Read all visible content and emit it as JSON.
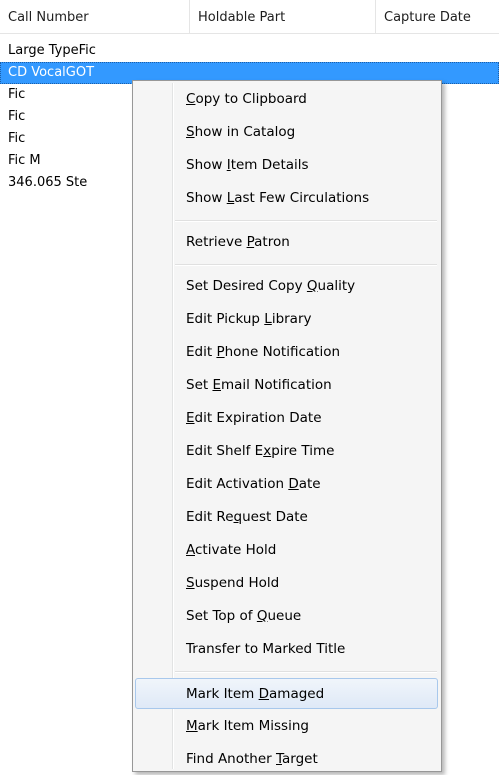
{
  "header": {
    "columns": [
      "Call Number",
      "Holdable Part",
      "Capture Date"
    ]
  },
  "rows": [
    {
      "call_number": "Large TypeFic",
      "selected": false
    },
    {
      "call_number": "CD VocalGOT",
      "selected": true
    },
    {
      "call_number": "Fic",
      "selected": false
    },
    {
      "call_number": "Fic",
      "selected": false
    },
    {
      "call_number": "Fic",
      "selected": false
    },
    {
      "call_number": "Fic M",
      "selected": false
    },
    {
      "call_number": "346.065 Ste",
      "selected": false
    }
  ],
  "context_menu": {
    "groups": [
      [
        {
          "label": "Copy to Clipboard",
          "accel": "C"
        },
        {
          "label": "Show in Catalog",
          "accel": "S"
        },
        {
          "label": "Show Item Details",
          "accel": "I"
        },
        {
          "label": "Show Last Few Circulations",
          "accel": "L"
        }
      ],
      [
        {
          "label": "Retrieve Patron",
          "accel": "P"
        }
      ],
      [
        {
          "label": "Set Desired Copy Quality",
          "accel": "Q"
        },
        {
          "label": "Edit Pickup Library",
          "accel": "L"
        },
        {
          "label": "Edit Phone Notification",
          "accel": "P"
        },
        {
          "label": "Set Email Notification",
          "accel": "E"
        },
        {
          "label": "Edit Expiration Date",
          "accel": "E"
        },
        {
          "label": "Edit Shelf Expire Time",
          "accel": "x"
        },
        {
          "label": "Edit Activation Date",
          "accel": "D"
        },
        {
          "label": "Edit Request Date",
          "accel": "q"
        },
        {
          "label": "Activate Hold",
          "accel": "A"
        },
        {
          "label": "Suspend Hold",
          "accel": "S"
        },
        {
          "label": "Set Top of Queue",
          "accel": "Q"
        },
        {
          "label": "Transfer to Marked Title",
          "accel": ""
        }
      ],
      [
        {
          "label": "Mark Item Damaged",
          "accel": "D",
          "hover": true
        },
        {
          "label": "Mark Item Missing",
          "accel": "M"
        },
        {
          "label": "Find Another Target",
          "accel": "T"
        }
      ]
    ]
  },
  "colors": {
    "selection": "#3399ff",
    "menu_background": "#f5f5f5",
    "menu_hover_border": "#a8c8ec"
  }
}
